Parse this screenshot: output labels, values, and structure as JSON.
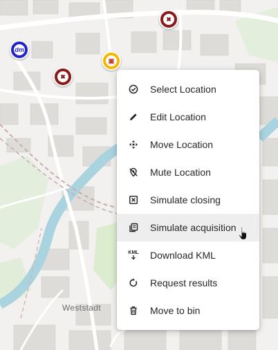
{
  "map": {
    "place_label": "Weststadt",
    "colors": {
      "background": "#f2f1ef",
      "building": "#dcdad6",
      "road": "#ffffff",
      "river": "#aad3df",
      "park": "#d8ead0",
      "rail": "#c9a8a8"
    },
    "markers": [
      {
        "name": "closed-location-marker-top",
        "icon": "closed-icon",
        "color": "#8b1a1a"
      },
      {
        "name": "dm-store-marker",
        "icon": "dm-logo-icon",
        "text": "dm",
        "color": "#2323c8"
      },
      {
        "name": "closed-location-marker-left",
        "icon": "closed-icon",
        "color": "#8b1a1a"
      },
      {
        "name": "selected-location-marker",
        "icon": "shop-icon",
        "color": "#f5b800"
      }
    ]
  },
  "context_menu": {
    "items": [
      {
        "label": "Select Location",
        "icon": "check-circle-icon"
      },
      {
        "label": "Edit Location",
        "icon": "pencil-icon"
      },
      {
        "label": "Move Location",
        "icon": "move-arrows-icon"
      },
      {
        "label": "Mute Location",
        "icon": "location-off-icon"
      },
      {
        "label": "Simulate closing",
        "icon": "close-box-icon"
      },
      {
        "label": "Simulate acquisition",
        "icon": "copy-document-icon"
      },
      {
        "label": "Download KML",
        "icon": "kml-download-icon",
        "icon_text": "KML"
      },
      {
        "label": "Request results",
        "icon": "refresh-icon"
      },
      {
        "label": "Move to bin",
        "icon": "trash-icon"
      }
    ],
    "hovered_item": "Simulate acquisition"
  }
}
